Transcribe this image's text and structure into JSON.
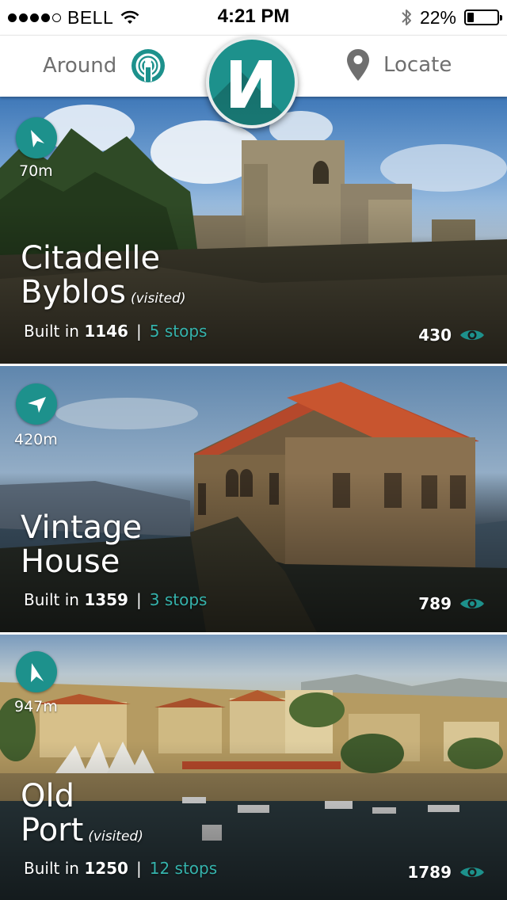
{
  "status_bar": {
    "carrier": "BELL",
    "time": "4:21 PM",
    "battery": "22%",
    "battery_level": 0.22
  },
  "nav": {
    "around_label": "Around",
    "locate_label": "Locate"
  },
  "colors": {
    "accent": "#1d918c",
    "stops": "#35b3ac"
  },
  "places": [
    {
      "name_line1": "Citadelle",
      "name_line2": "Byblos",
      "visited": "(visited)",
      "built_label": "Built in",
      "year": "1146",
      "stops": "5 stops",
      "views": "430",
      "distance": "70m"
    },
    {
      "name_line1": "Vintage",
      "name_line2": "House",
      "visited": "",
      "built_label": "Built in",
      "year": "1359",
      "stops": "3 stops",
      "views": "789",
      "distance": "420m"
    },
    {
      "name_line1": "Old",
      "name_line2": "Port",
      "visited": "(visited)",
      "built_label": "Built in",
      "year": "1250",
      "stops": "12 stops",
      "views": "1789",
      "distance": "947m"
    }
  ]
}
